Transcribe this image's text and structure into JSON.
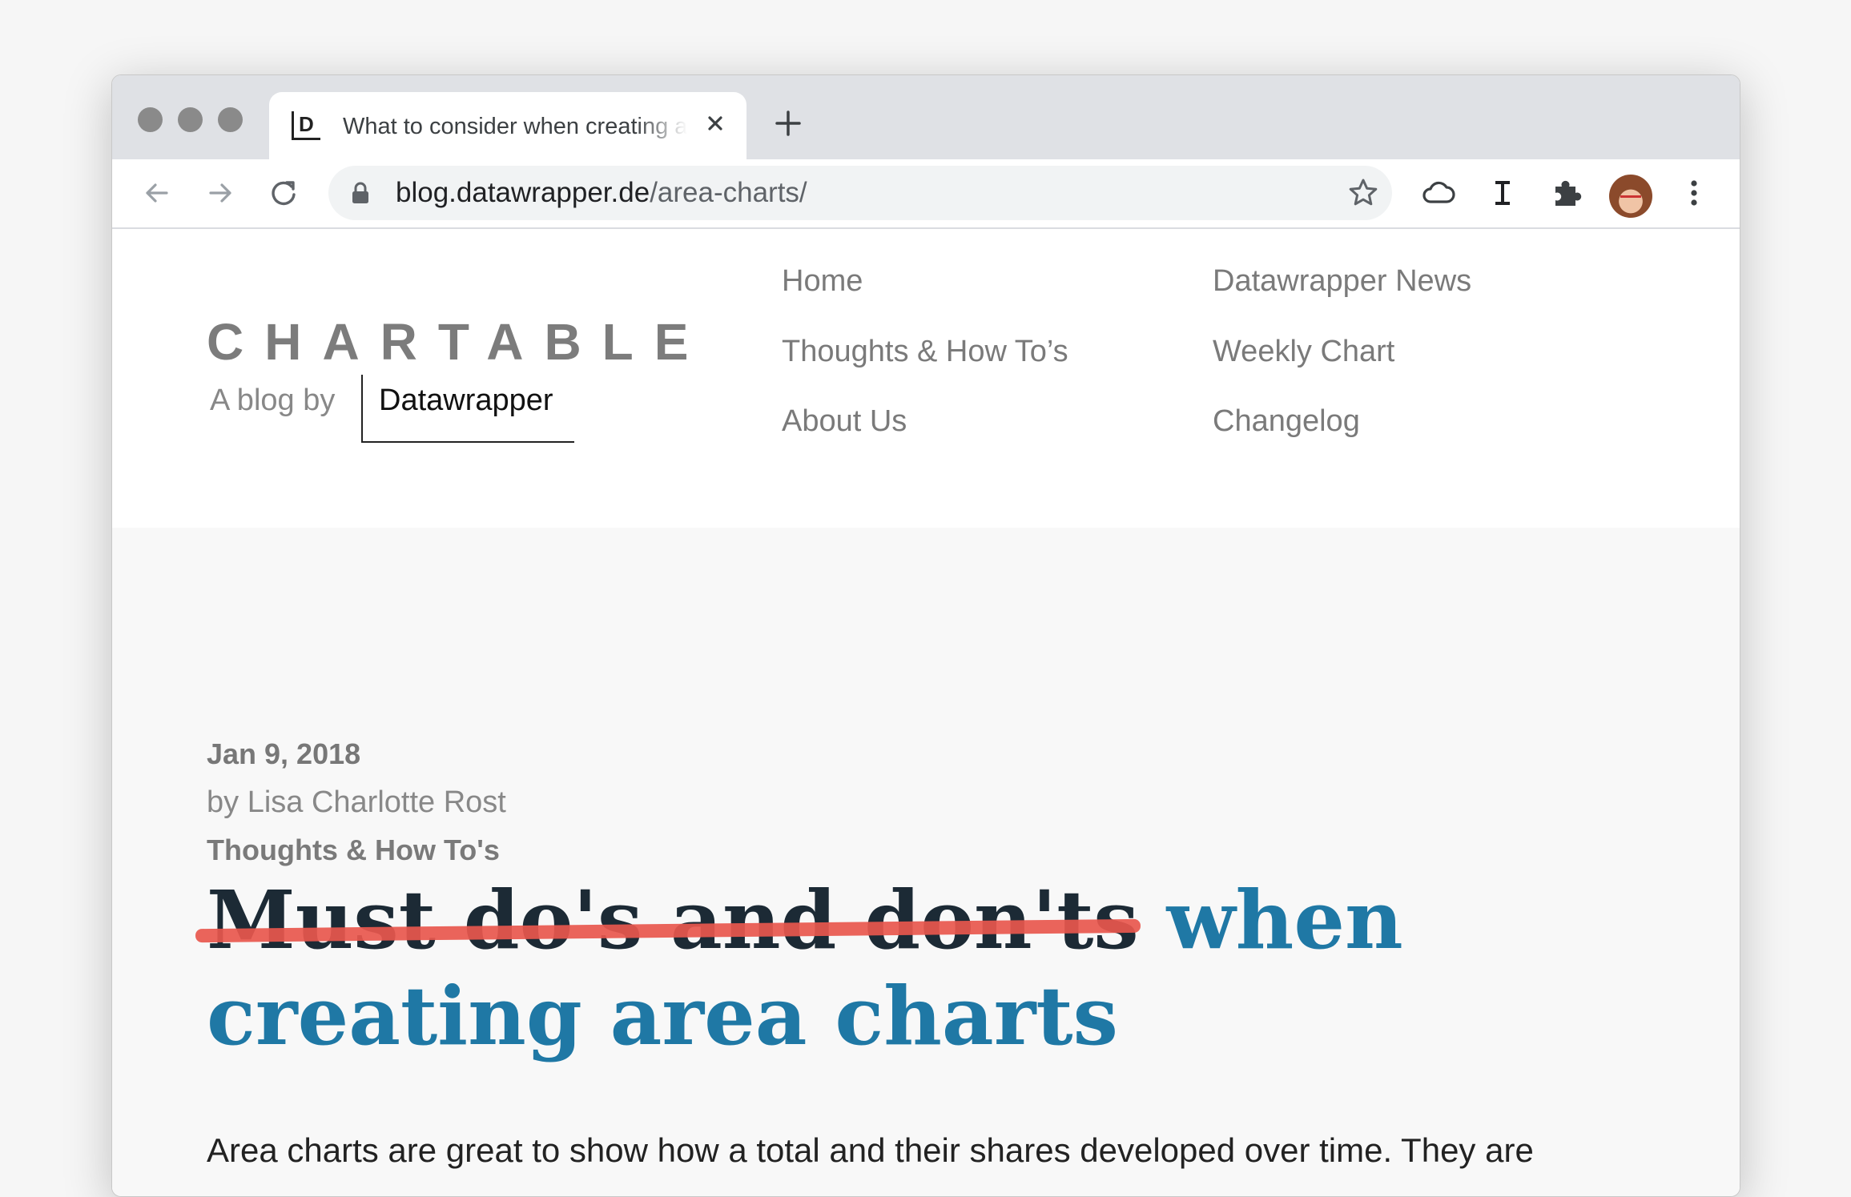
{
  "browser": {
    "tab_title": "What to consider when creating area charts",
    "url_host": "blog.datawrapper.de",
    "url_path": "/area-charts/"
  },
  "site": {
    "brand": "CHARTABLE",
    "tagline": "A blog by",
    "brand_owner": "Datawrapper",
    "nav": {
      "home": "Home",
      "thoughts": "Thoughts & How To’s",
      "about": "About Us",
      "news": "Datawrapper News",
      "weekly": "Weekly Chart",
      "changelog": "Changelog"
    }
  },
  "article": {
    "date": "Jan 9, 2018",
    "author": "by Lisa Charlotte Rost",
    "category": "Thoughts & How To's",
    "headline_struck": "Must do's and don'ts",
    "headline_rest": " when creating area charts",
    "intro": "Area charts are great to show how a total and their shares developed over time. They are"
  }
}
